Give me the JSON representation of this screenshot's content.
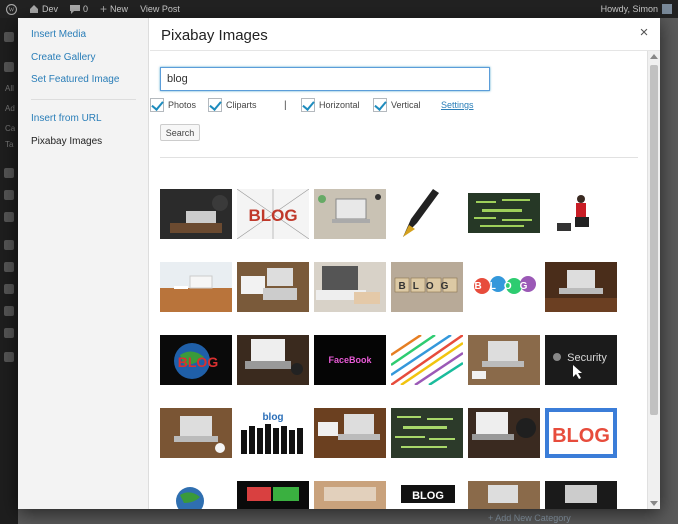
{
  "admin_bar": {
    "site_name": "Dev",
    "comments_count": "0",
    "new_label": "New",
    "view_post_label": "View Post",
    "greeting": "Howdy, Simon"
  },
  "admin_menu": {
    "partial_labels": [
      "All",
      "Ad",
      "Ca",
      "Ta"
    ]
  },
  "background": {
    "footer_text": "+ Add New Category"
  },
  "modal": {
    "title": "Pixabay Images",
    "close_glyph": "×",
    "menu": {
      "items": [
        "Insert Media",
        "Create Gallery",
        "Set Featured Image"
      ],
      "secondary_items": [
        "Insert from URL",
        "Pixabay Images"
      ],
      "active": "Pixabay Images"
    },
    "search": {
      "value": "blog",
      "button_label": "Search"
    },
    "options": [
      {
        "label": "Photos",
        "checked": true
      },
      {
        "label": "Cliparts",
        "checked": true
      },
      {
        "label": "Horizontal",
        "checked": true
      },
      {
        "label": "Vertical",
        "checked": true
      }
    ],
    "separator": "|",
    "settings_label": "Settings",
    "results": {
      "thumb_text": {
        "t1": "BLOG",
        "t13": "FaceBook",
        "t18": "Security",
        "t20": "BLOG",
        "t24": "blog",
        "t27": "BLOG",
        "t8": "BLOG",
        "t11": "BLOG"
      }
    }
  },
  "colors": {
    "link": "#2a7eb8",
    "accent": "#1e8cbe",
    "admin_bar_bg": "#222222",
    "overlay_bg": "#4a4a4a"
  }
}
